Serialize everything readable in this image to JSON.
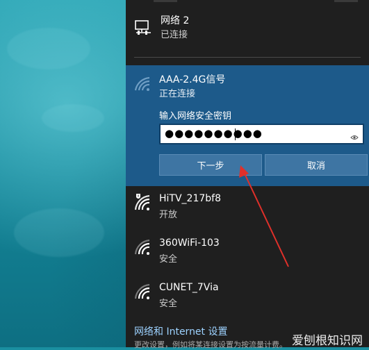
{
  "networks": [
    {
      "name": "网络 2",
      "status": "已连接",
      "icon": "ethernet-icon"
    },
    {
      "name": "AAA-2.4G信号",
      "status": "正在连接",
      "icon": "wifi-icon"
    },
    {
      "name": "HiTV_217bf8",
      "status": "开放",
      "icon": "wifi-shield-icon"
    },
    {
      "name": "360WiFi-103",
      "status": "安全",
      "icon": "wifi-icon"
    },
    {
      "name": "CUNET_7Via",
      "status": "安全",
      "icon": "wifi-icon"
    }
  ],
  "password": {
    "label": "输入网络安全密钥",
    "masked_value": "●●●●●●●●●●"
  },
  "buttons": {
    "next": "下一步",
    "cancel": "取消"
  },
  "settings": {
    "link": "网络和 Internet 设置",
    "description": "更改设置，例如将某连接设置为按流量计费。"
  },
  "watermark": "爱刨根知识网",
  "colors": {
    "panel": "#1f1f1f",
    "active": "#1d5a8a",
    "button": "#3e75a3",
    "link": "#9dd2ff",
    "arrow": "#e0302a"
  }
}
